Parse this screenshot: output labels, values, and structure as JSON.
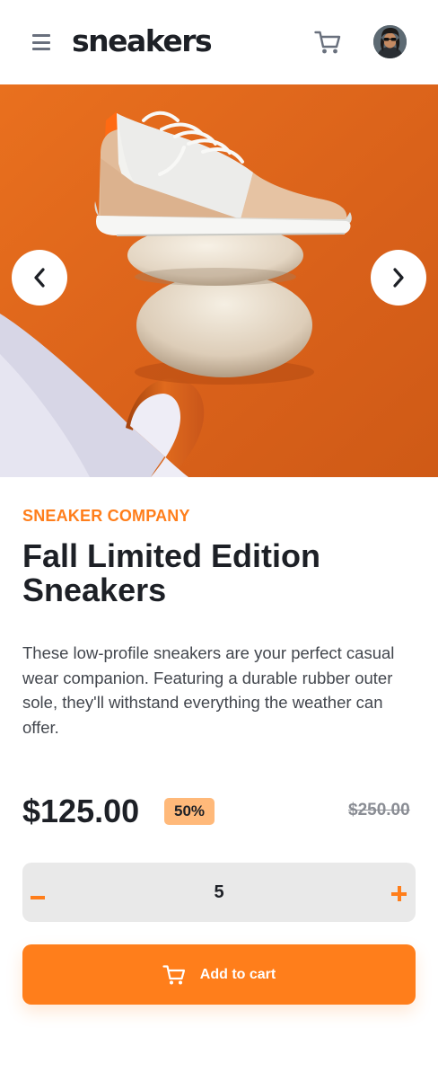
{
  "header": {
    "logo": "sneakers",
    "menu_icon": "hamburger-menu-icon",
    "cart_icon": "cart-icon",
    "avatar_icon": "user-avatar"
  },
  "gallery": {
    "prev_icon": "chevron-left-icon",
    "next_icon": "chevron-right-icon"
  },
  "product": {
    "company": "SNEAKER COMPANY",
    "title": "Fall Limited Edition Sneakers",
    "description": "These low-profile sneakers are your perfect casual wear companion. Featuring a durable rubber outer sole, they'll withstand everything the weather can offer.",
    "price": "$125.00",
    "discount": "50%",
    "original_price": "$250.00"
  },
  "quantity": {
    "value": "5",
    "minus_icon": "minus-icon",
    "plus_icon": "plus-icon"
  },
  "add_to_cart": {
    "label": "Add to cart",
    "icon": "cart-icon"
  },
  "colors": {
    "accent": "#ff7e1b",
    "accent_pale": "#ffb97a",
    "text_dark": "#1d2026",
    "text_muted": "#69707d",
    "field_bg": "#e9e9e9"
  }
}
